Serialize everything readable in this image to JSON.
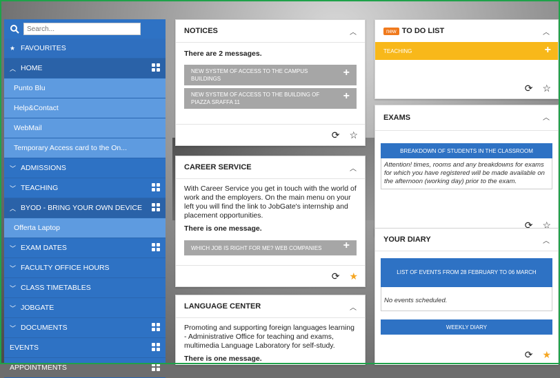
{
  "search": {
    "placeholder": "Search..."
  },
  "sidebar": {
    "items": [
      {
        "label": "FAVOURITES",
        "icon": "star"
      },
      {
        "label": "HOME",
        "icon": "chevron-up",
        "grid": true
      },
      {
        "label": "Punto Blu",
        "sub": true
      },
      {
        "label": "Help&Contact",
        "sub": true
      },
      {
        "label": "WebMail",
        "sub": true
      },
      {
        "label": "Temporary Access card to the On...",
        "sub": true
      },
      {
        "label": "ADMISSIONS",
        "icon": "chevron-down"
      },
      {
        "label": "TEACHING",
        "icon": "chevron-down",
        "grid": true
      },
      {
        "label": "BYOD - BRING YOUR OWN DEVICE",
        "icon": "chevron-up",
        "grid": true
      },
      {
        "label": "Offerta Laptop",
        "sub": true
      },
      {
        "label": "EXAM DATES",
        "icon": "chevron-down",
        "grid": true
      },
      {
        "label": "FACULTY OFFICE HOURS",
        "icon": "chevron-down"
      },
      {
        "label": "CLASS TIMETABLES",
        "icon": "chevron-down"
      },
      {
        "label": "JOBGATE",
        "icon": "chevron-down"
      },
      {
        "label": "DOCUMENTS",
        "icon": "chevron-down",
        "grid": true
      },
      {
        "label": "EVENTS",
        "grid": true
      },
      {
        "label": "APPOINTMENTS",
        "grid": true
      }
    ]
  },
  "notices": {
    "title": "NOTICES",
    "summary": "There are 2 messages.",
    "messages": [
      "NEW SYSTEM OF ACCESS TO THE CAMPUS BUILDINGS",
      "NEW SYSTEM OF ACCESS TO THE BUILDING OF PIAZZA SRAFFA 11"
    ]
  },
  "career": {
    "title": "CAREER SERVICE",
    "text": "With Career Service you get in touch with the world of work and the employers. On the main menu on your left you will find the link to JobGate's internship and placement opportunities.",
    "summary": "There is one message.",
    "message": "WHICH JOB IS RIGHT FOR ME? WEB COMPANIES"
  },
  "language": {
    "title": "LANGUAGE CENTER",
    "text": "Promoting and supporting foreign languages learning - Administrative Office for teaching and exams, multimedia Language Laboratory for self-study.",
    "summary": "There is one message."
  },
  "todo": {
    "badge": "new",
    "title": "TO DO LIST",
    "item": "TEACHING"
  },
  "exams": {
    "title": "EXAMS",
    "button": "BREAKDOWN OF STUDENTS IN THE CLASSROOM",
    "note": "Attention! times, rooms and any breakdowns for exams for which you have registered will be made available on the afternoon (working day) prior to the exam."
  },
  "diary": {
    "title": "YOUR DIARY",
    "events_button": "LIST OF EVENTS FROM 28 FEBRUARY TO 06 MARCH",
    "empty": "No events scheduled.",
    "weekly": "WEEKLY DIARY"
  },
  "colors": {
    "accent": "#2e72c4",
    "submenu": "#5e9be0",
    "todo": "#f8b81a",
    "star_active": "#f5a623",
    "new_badge": "#f07a1d"
  }
}
